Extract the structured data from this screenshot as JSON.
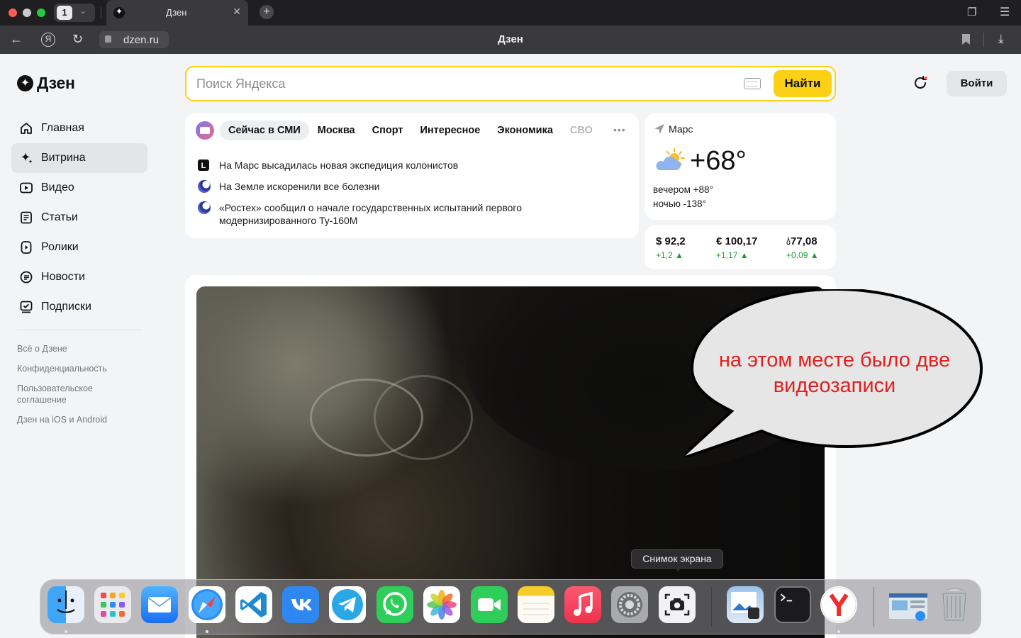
{
  "browser": {
    "tab_count": "1",
    "tab_title": "Дзен",
    "url": "dzen.ru",
    "page_title": "Дзен"
  },
  "header": {
    "logo_text": "Дзен",
    "search_placeholder": "Поиск Яндекса",
    "search_button": "Найти",
    "login_button": "Войти"
  },
  "sidebar": {
    "items": [
      {
        "label": "Главная",
        "icon": "home-icon"
      },
      {
        "label": "Витрина",
        "icon": "sparkle-icon",
        "active": true
      },
      {
        "label": "Видео",
        "icon": "video-icon"
      },
      {
        "label": "Статьи",
        "icon": "article-icon"
      },
      {
        "label": "Ролики",
        "icon": "clips-icon"
      },
      {
        "label": "Новости",
        "icon": "news-icon"
      },
      {
        "label": "Подписки",
        "icon": "subscriptions-icon"
      }
    ],
    "footer_links": [
      "Всё о Дзене",
      "Конфиденциальность",
      "Пользовательское соглашение",
      "Дзен на iOS и Android"
    ]
  },
  "news": {
    "tabs": [
      "Сейчас в СМИ",
      "Москва",
      "Спорт",
      "Интересное",
      "Экономика",
      "СВО"
    ],
    "more": "•••",
    "items": [
      {
        "source_icon": "L",
        "text": "На Марс высадилась новая экспедиция колонистов"
      },
      {
        "source_icon": "sphere",
        "text": "На Земле искоренили все болезни"
      },
      {
        "source_icon": "sphere",
        "text": "«Ростех» сообщил о начале государственных испытаний первого модернизированного Ту-160М"
      }
    ]
  },
  "weather": {
    "location": "Марс",
    "temperature": "+68°",
    "evening": "вечером +88°",
    "night": "ночью -138°"
  },
  "rates": [
    {
      "value": "$ 92,2",
      "change": "+1,2 ▲"
    },
    {
      "value": "€ 100,17",
      "change": "+1,17 ▲"
    },
    {
      "value": "77,08",
      "change": "+0,09 ▲",
      "icon": "oil-drop-icon"
    }
  ],
  "annotation": {
    "text": "на этом месте было две видеозаписи"
  },
  "tooltip": {
    "text": "Снимок экрана"
  },
  "dock": {
    "apps": [
      "Finder",
      "Launchpad",
      "Mail",
      "Safari",
      "VS Code",
      "VK",
      "Telegram",
      "WhatsApp",
      "Photos",
      "FaceTime",
      "Notes",
      "Music",
      "System Settings",
      "Screenshot",
      "Preview",
      "Terminal",
      "Yandex Browser",
      "Downloads",
      "Trash"
    ]
  },
  "colors": {
    "accent_yellow": "#fcd015",
    "rate_up": "#21a038",
    "annotation_red": "#e02020"
  }
}
